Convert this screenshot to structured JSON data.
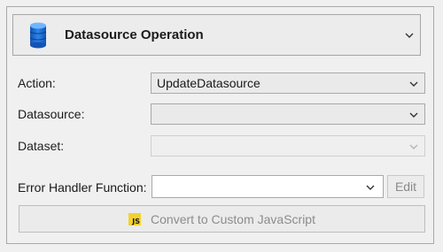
{
  "header": {
    "title": "Datasource Operation",
    "icon": "database-icon",
    "icon_color": "#1f6fd1"
  },
  "form": {
    "action_label": "Action:",
    "action_value": "UpdateDatasource",
    "datasource_label": "Datasource:",
    "datasource_value": "",
    "dataset_label": "Dataset:",
    "dataset_value": "",
    "error_handler_label": "Error Handler Function:",
    "error_handler_value": "",
    "edit_label": "Edit"
  },
  "convert": {
    "label": "Convert to Custom JavaScript",
    "badge_text": "JS",
    "badge_color": "#f2d22e"
  }
}
